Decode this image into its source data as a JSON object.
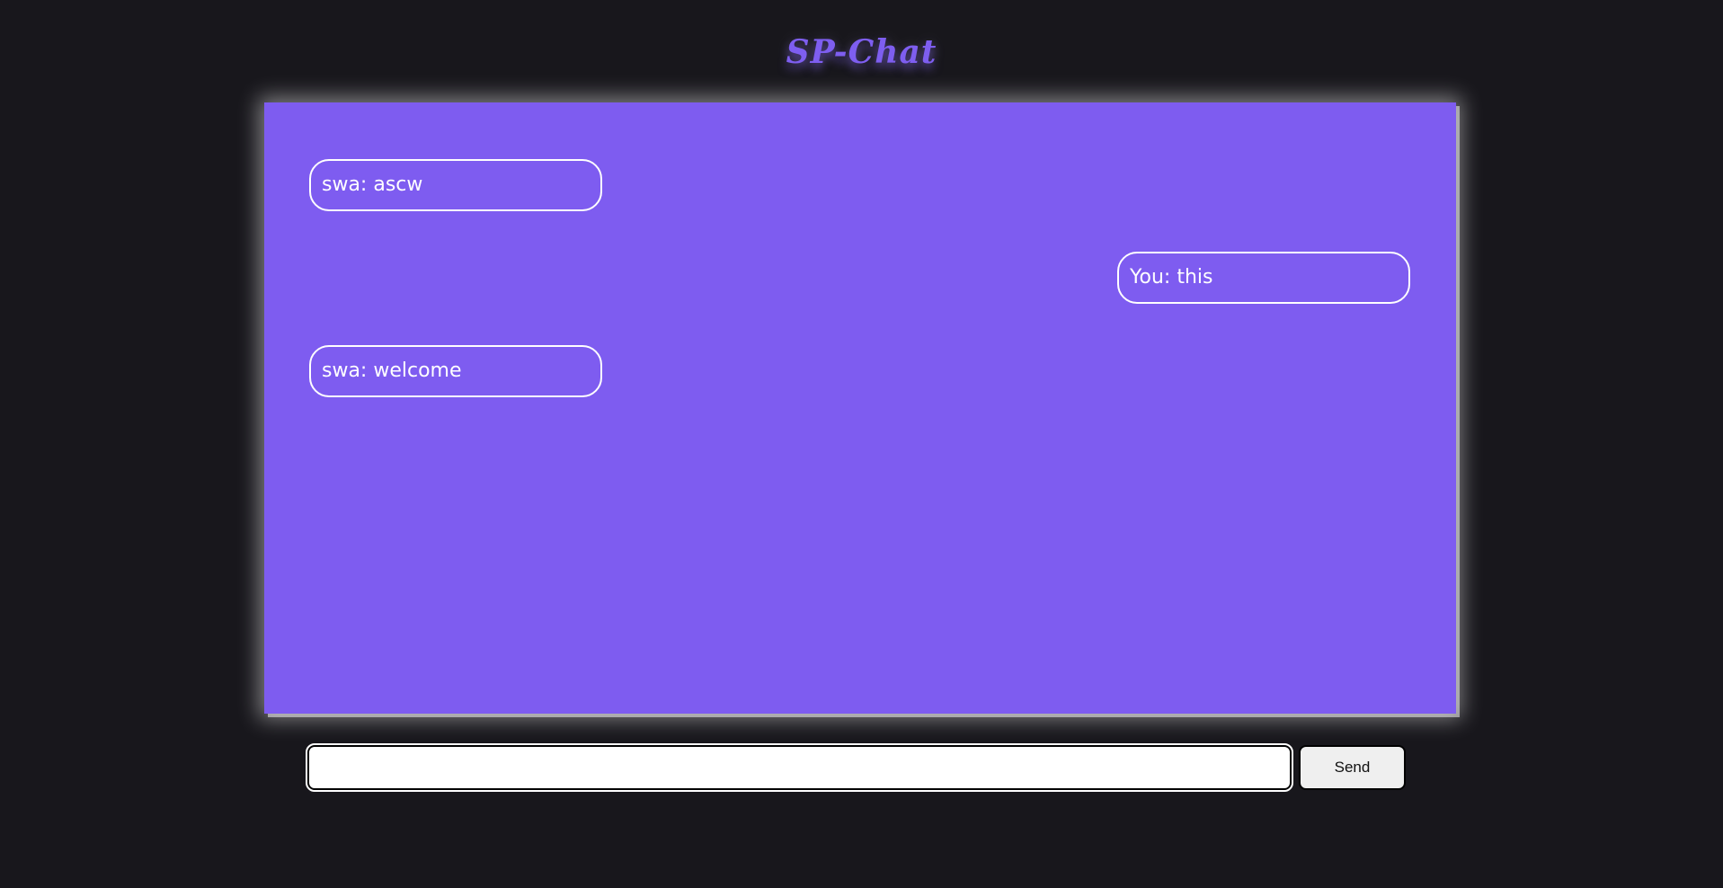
{
  "app": {
    "title": "SP-Chat"
  },
  "messages": [
    {
      "text": "swa: ascw",
      "side": "left"
    },
    {
      "text": "You: this",
      "side": "right"
    },
    {
      "text": "swa: welcome",
      "side": "left"
    }
  ],
  "composer": {
    "input_value": "",
    "send_label": "Send"
  },
  "colors": {
    "background": "#18171c",
    "chat_panel": "#7e5cf0",
    "accent": "#7e5ef0"
  }
}
